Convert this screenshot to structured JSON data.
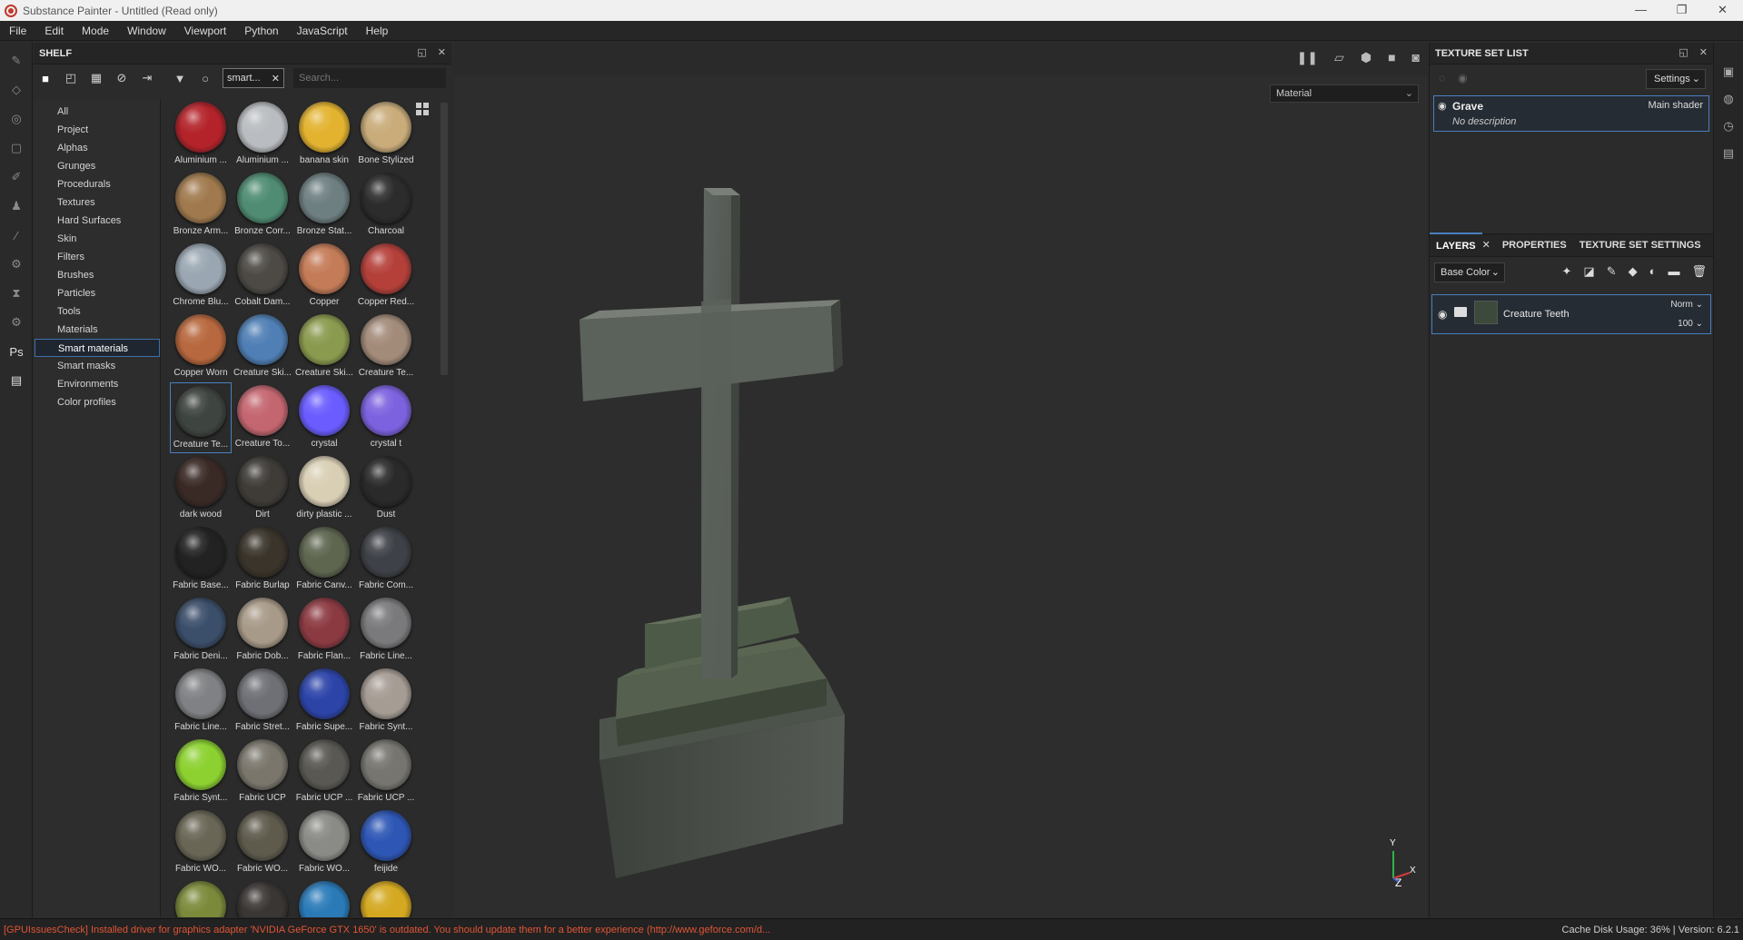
{
  "window": {
    "title": "Substance Painter - Untitled (Read only)",
    "min": "—",
    "max": "❐",
    "close": "✕"
  },
  "menu": [
    "File",
    "Edit",
    "Mode",
    "Window",
    "Viewport",
    "Python",
    "JavaScript",
    "Help"
  ],
  "shelf": {
    "title": "SHELF",
    "filter_tag": "smart...",
    "search_placeholder": "Search...",
    "categories": [
      "All",
      "Project",
      "Alphas",
      "Grunges",
      "Procedurals",
      "Textures",
      "Hard Surfaces",
      "Skin",
      "Filters",
      "Brushes",
      "Particles",
      "Tools",
      "Materials",
      "Smart materials",
      "Smart masks",
      "Environments",
      "Color profiles"
    ],
    "selected_category": "Smart materials",
    "materials": [
      {
        "label": "Aluminium ...",
        "color": "#b4232a"
      },
      {
        "label": "Aluminium ...",
        "color": "#b9bcc0"
      },
      {
        "label": "banana skin",
        "color": "#e3b330"
      },
      {
        "label": "Bone Stylized",
        "color": "#c9ac7a"
      },
      {
        "label": "Bronze Arm...",
        "color": "#a07a4e"
      },
      {
        "label": "Bronze Corr...",
        "color": "#4f8c73"
      },
      {
        "label": "Bronze Stat...",
        "color": "#6e7f82"
      },
      {
        "label": "Charcoal",
        "color": "#2c2c2c"
      },
      {
        "label": "Chrome Blu...",
        "color": "#9aa7b2"
      },
      {
        "label": "Cobalt Dam...",
        "color": "#4d4a45"
      },
      {
        "label": "Copper",
        "color": "#c47b57"
      },
      {
        "label": "Copper Red...",
        "color": "#b5403a"
      },
      {
        "label": "Copper Worn",
        "color": "#b8683e"
      },
      {
        "label": "Creature Ski...",
        "color": "#4f7fb5"
      },
      {
        "label": "Creature Ski...",
        "color": "#8a9a4e"
      },
      {
        "label": "Creature Te...",
        "color": "#a38b7a"
      },
      {
        "label": "Creature Te...",
        "color": "#3e4440"
      },
      {
        "label": "Creature To...",
        "color": "#c46670"
      },
      {
        "label": "crystal",
        "color": "#6a5cff"
      },
      {
        "label": "crystal t",
        "color": "#7d62e0"
      },
      {
        "label": "dark wood",
        "color": "#3a2a26"
      },
      {
        "label": "Dirt",
        "color": "#3f3c38"
      },
      {
        "label": "dirty plastic ...",
        "color": "#d9cfb5"
      },
      {
        "label": "Dust",
        "color": "#2a2a2a"
      },
      {
        "label": "Fabric Base...",
        "color": "#222222"
      },
      {
        "label": "Fabric Burlap",
        "color": "#3a342a"
      },
      {
        "label": "Fabric Canv...",
        "color": "#5e6650"
      },
      {
        "label": "Fabric Com...",
        "color": "#3e4147"
      },
      {
        "label": "Fabric Deni...",
        "color": "#3b4e6a"
      },
      {
        "label": "Fabric Dob...",
        "color": "#a89a88"
      },
      {
        "label": "Fabric Flan...",
        "color": "#8c3a42"
      },
      {
        "label": "Fabric Line...",
        "color": "#7a7a7c"
      },
      {
        "label": "Fabric Line...",
        "color": "#808184"
      },
      {
        "label": "Fabric Stret...",
        "color": "#6e7076"
      },
      {
        "label": "Fabric Supe...",
        "color": "#2c44a8"
      },
      {
        "label": "Fabric Synt...",
        "color": "#a59c94"
      },
      {
        "label": "Fabric Synt...",
        "color": "#8cd130"
      },
      {
        "label": "Fabric UCP",
        "color": "#7a766c"
      },
      {
        "label": "Fabric UCP ...",
        "color": "#5a5852"
      },
      {
        "label": "Fabric UCP ...",
        "color": "#77756f"
      },
      {
        "label": "Fabric WO...",
        "color": "#6a6656"
      },
      {
        "label": "Fabric WO...",
        "color": "#5e5a4c"
      },
      {
        "label": "Fabric WO...",
        "color": "#8a8a86"
      },
      {
        "label": "feijide",
        "color": "#2d56b5"
      },
      {
        "label": "",
        "color": "#7a8a3a"
      },
      {
        "label": "",
        "color": "#3a3634"
      },
      {
        "label": "",
        "color": "#2a7ab8"
      },
      {
        "label": "",
        "color": "#d4a820"
      }
    ]
  },
  "viewport": {
    "mode_select": "Material",
    "axis_y": "Y",
    "axis_x": "X",
    "axis_z": "Z"
  },
  "texture_set_list": {
    "title": "TEXTURE SET LIST",
    "settings_label": "Settings",
    "item": {
      "name": "Grave",
      "shader": "Main shader",
      "description": "No description"
    }
  },
  "tabs": [
    "LAYERS",
    "PROPERTIES",
    "TEXTURE SET SETTINGS"
  ],
  "layers": {
    "channel": "Base Color",
    "item": {
      "name": "Creature Teeth",
      "blend": "Norm",
      "opacity": "100"
    }
  },
  "status": {
    "error": "[GPUIssuesCheck] Installed driver for graphics adapter 'NVIDIA GeForce GTX 1650' is outdated. You should update them for a better experience (http://www.geforce.com/d...",
    "info": "Cache Disk Usage:    36% | Version: 6.2.1"
  }
}
